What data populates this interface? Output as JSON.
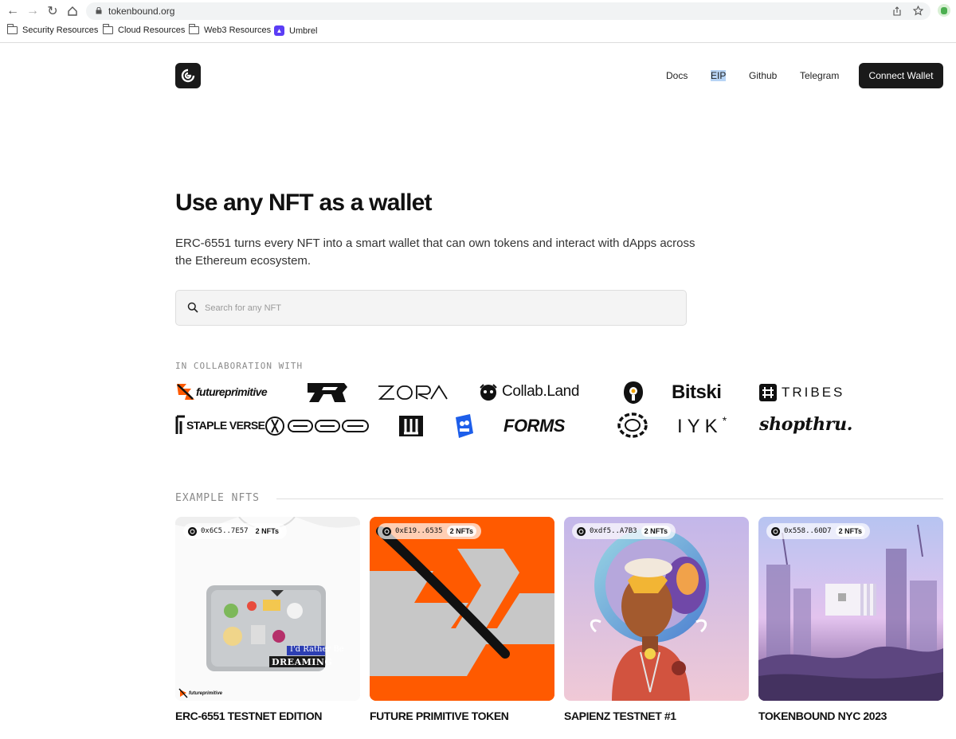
{
  "browser": {
    "url": "tokenbound.org",
    "bookmarks": [
      {
        "label": "Security Resources"
      },
      {
        "label": "Cloud Resources"
      },
      {
        "label": "Web3 Resources"
      },
      {
        "label": "Umbrel"
      }
    ]
  },
  "header": {
    "nav": [
      "Docs",
      "EIP",
      "Github",
      "Telegram"
    ],
    "connect_label": "Connect Wallet"
  },
  "hero": {
    "title": "Use any NFT as a wallet",
    "subtitle": "ERC-6551 turns every NFT into a smart wallet that can own tokens and interact with dApps across the Ethereum ecosystem.",
    "search_placeholder": "Search for any NFT"
  },
  "collab": {
    "label": "IN COLLABORATION WITH",
    "partners": [
      "futureprimitive",
      "ZORA",
      "Collab.Land",
      "Bitski",
      "TRIBES",
      "STAPLE VERSE",
      "FORMS",
      "IYK",
      "shopthru."
    ]
  },
  "examples": {
    "label": "EXAMPLE NFTS",
    "cards": [
      {
        "address": "0x6C5..7E57",
        "count": "2 NFTs",
        "title": "ERC-6551 TESTNET EDITION",
        "sticker": "I'd Rather Be",
        "sticker2": "DREAMING",
        "brand": "futureprimitive"
      },
      {
        "address": "0xE19..6535",
        "count": "2 NFTs",
        "title": "FUTURE PRIMITIVE TOKEN"
      },
      {
        "address": "0xdf5..A7B3",
        "count": "2 NFTs",
        "title": "SAPIENZ TESTNET #1"
      },
      {
        "address": "0x558..60D7",
        "count": "2 NFTs",
        "title": "TOKENBOUND NYC 2023"
      }
    ]
  },
  "colors": {
    "accent_orange": "#ff5a00",
    "dark": "#1a1a1a"
  }
}
